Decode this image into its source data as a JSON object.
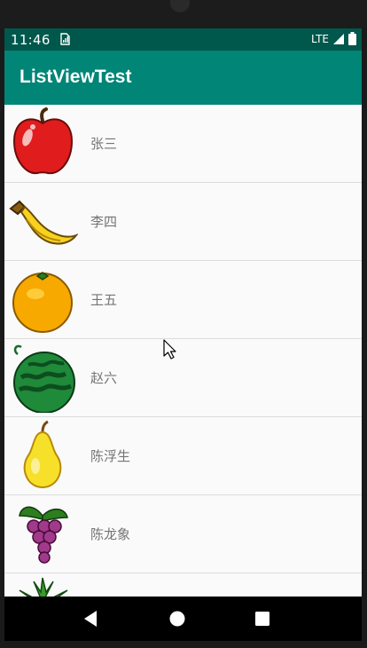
{
  "status_bar": {
    "time": "11:46",
    "network": "LTE",
    "icons": [
      "sim-card-icon",
      "cell-signal-icon",
      "battery-icon"
    ]
  },
  "app_bar": {
    "title": "ListViewTest"
  },
  "list": {
    "items": [
      {
        "label": "张三",
        "icon": "apple-icon"
      },
      {
        "label": "李四",
        "icon": "banana-icon"
      },
      {
        "label": "王五",
        "icon": "orange-icon"
      },
      {
        "label": "赵六",
        "icon": "watermelon-icon"
      },
      {
        "label": "陈浮生",
        "icon": "pear-icon"
      },
      {
        "label": "陈龙象",
        "icon": "grape-icon"
      },
      {
        "label": "",
        "icon": "pineapple-icon"
      }
    ]
  },
  "nav_bar": {
    "buttons": [
      "back-icon",
      "home-icon",
      "recents-icon"
    ]
  },
  "colors": {
    "status_bar": "#00574b",
    "app_bar": "#008577",
    "list_background": "#fafafa",
    "label_text": "#757575",
    "divider": "#dcdcdc"
  }
}
